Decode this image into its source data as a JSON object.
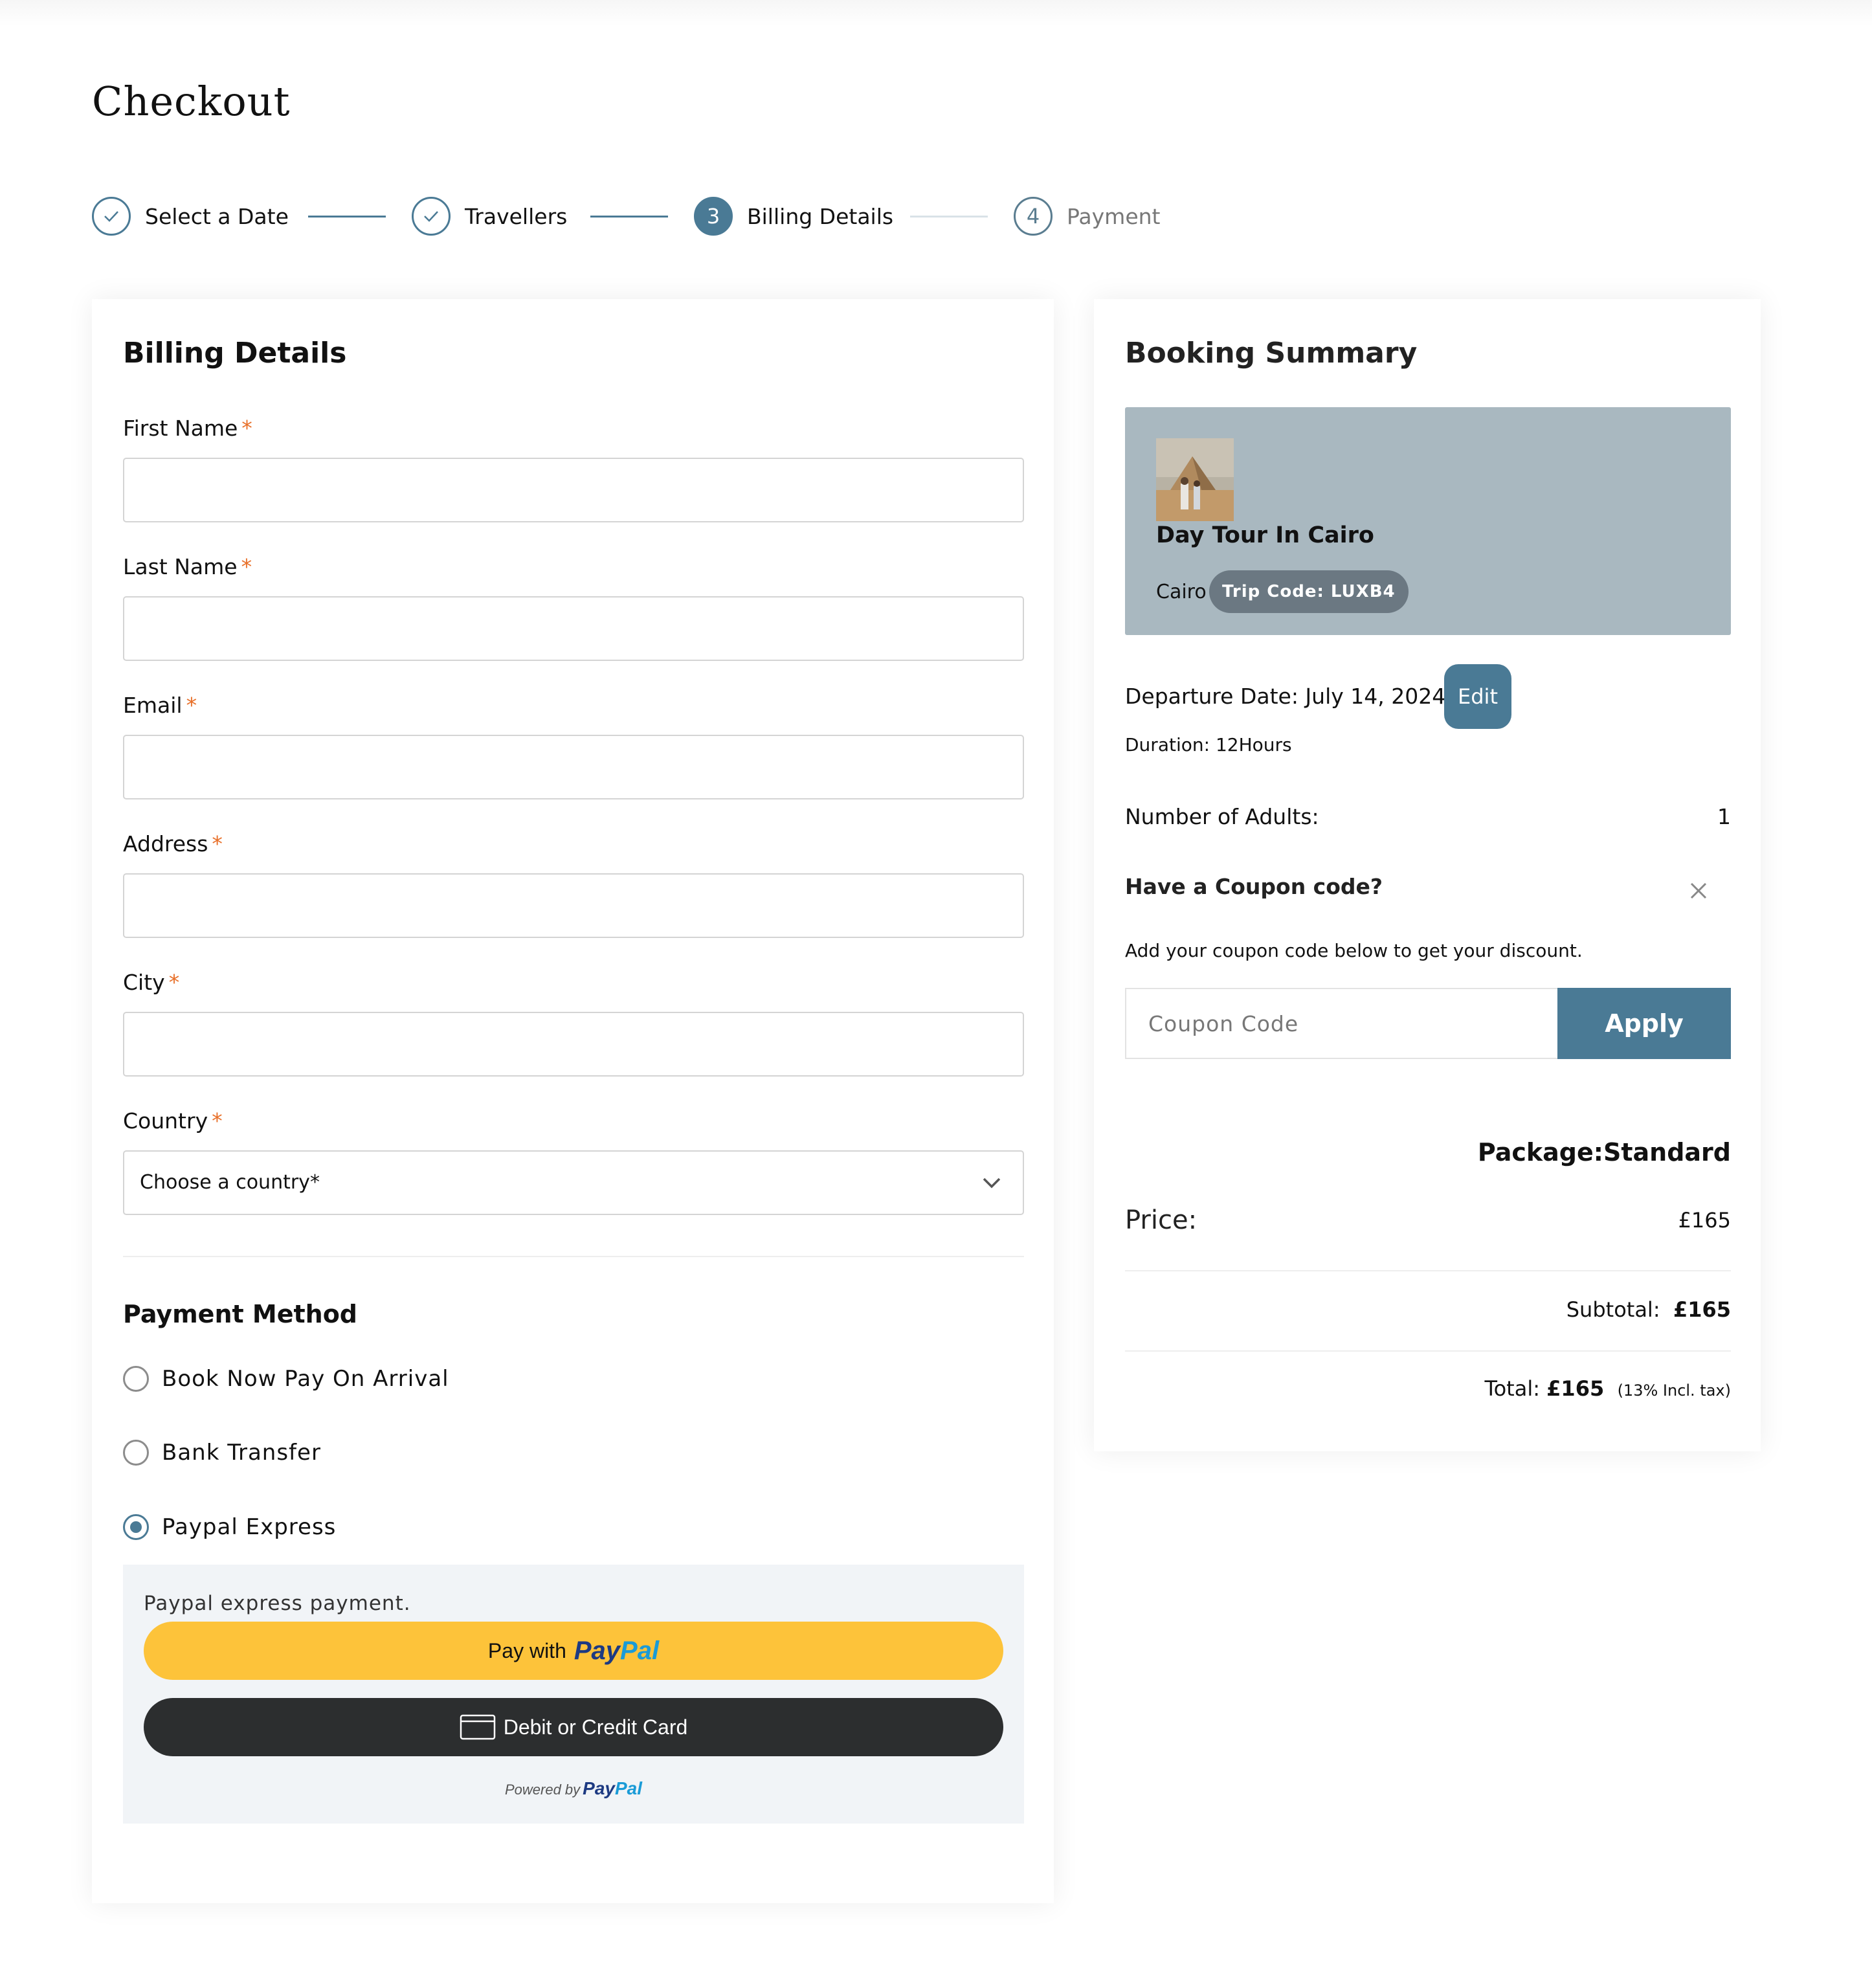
{
  "page": {
    "title": "Checkout"
  },
  "stepper": {
    "steps": [
      {
        "marker": "",
        "label": "Select a Date",
        "state": "done"
      },
      {
        "marker": "",
        "label": "Travellers",
        "state": "done"
      },
      {
        "marker": "3",
        "label": "Billing Details",
        "state": "active"
      },
      {
        "marker": "4",
        "label": "Payment",
        "state": "future"
      }
    ]
  },
  "billing": {
    "title": "Billing Details",
    "fields": [
      {
        "label": "First Name",
        "required": "*",
        "value": ""
      },
      {
        "label": "Last Name",
        "required": "*",
        "value": ""
      },
      {
        "label": "Email",
        "required": "*",
        "value": ""
      },
      {
        "label": "Address",
        "required": "*",
        "value": ""
      },
      {
        "label": "City",
        "required": "*",
        "value": ""
      },
      {
        "label": "Country",
        "required": "*",
        "value": "Choose a country*"
      }
    ]
  },
  "payment": {
    "title": "Payment Method",
    "options": [
      {
        "label": "Book Now Pay On Arrival",
        "checked": false
      },
      {
        "label": "Bank Transfer",
        "checked": false
      },
      {
        "label": "Paypal Express",
        "checked": true
      }
    ],
    "paypal": {
      "description": "Paypal express payment.",
      "pay_with": "Pay with",
      "logo_pay": "Pay",
      "logo_pal": "Pal",
      "card_button": "Debit or Credit Card",
      "powered_by": "Powered by"
    }
  },
  "summary": {
    "title": "Booking Summary",
    "tour": {
      "name": "Day Tour In Cairo",
      "city": "Cairo",
      "trip_code": "Trip Code: LUXB4"
    },
    "departure": "Departure Date: July 14, 2024",
    "edit_label": "Edit",
    "duration": "Duration: 12Hours",
    "adults_label": "Number of Adults:",
    "adults_value": "1",
    "coupon_title": "Have a Coupon code?",
    "coupon_hint": "Add your coupon code below to get your discount.",
    "coupon_placeholder": "Coupon Code",
    "apply_label": "Apply",
    "package": "Package:Standard",
    "price_label": "Price:",
    "price_value": "£165",
    "subtotal_label": "Subtotal:",
    "subtotal_value": "£165",
    "total_label": "Total:",
    "total_value": "£165",
    "tax_note": "(13% Incl. tax)"
  },
  "colors": {
    "accent": "#4a7a95",
    "required": "#e8702a",
    "paypal_yellow": "#fdc33a",
    "paypal_dark": "#2c2e2f",
    "tour_bg": "#a9b8c0"
  }
}
